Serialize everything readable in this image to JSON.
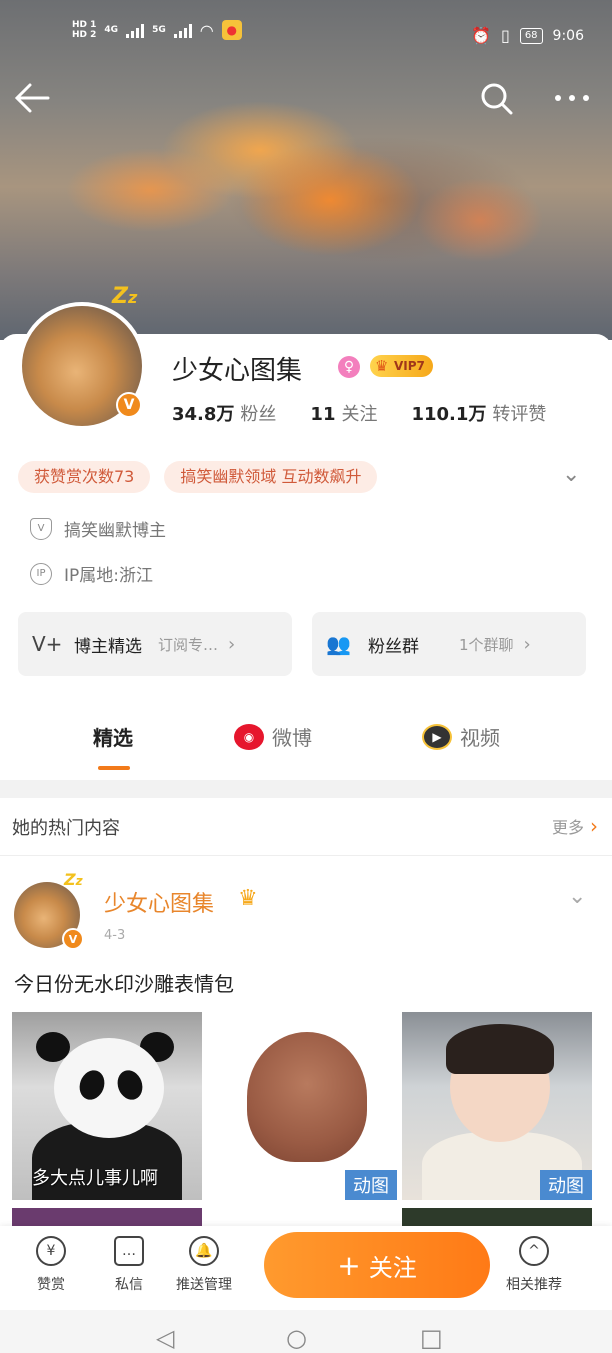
{
  "status_bar": {
    "sim1": "HD 1",
    "sim2": "HD 2",
    "net1": "4G",
    "net2": "5G",
    "battery": "68",
    "time": "9:06"
  },
  "nav": {
    "back_icon": "back-arrow",
    "search_icon": "search",
    "more_icon": "more-dots"
  },
  "profile": {
    "name": "少女心图集",
    "vip": "VIP7",
    "stats": [
      {
        "value": "34.8万",
        "label": "粉丝"
      },
      {
        "value": "11",
        "label": "关注"
      },
      {
        "value": "110.1万",
        "label": "转评赞"
      }
    ],
    "tags": [
      "获赞赏次数73",
      "搞笑幽默领域 互动数飙升"
    ],
    "role": "搞笑幽默博主",
    "ip": "IP属地:浙江",
    "boxes": [
      {
        "title": "博主精选",
        "sub": "订阅专…"
      },
      {
        "title": "粉丝群",
        "sub": "1个群聊"
      }
    ]
  },
  "tabs": [
    {
      "label": "精选",
      "active": true
    },
    {
      "label": "微博",
      "active": false
    },
    {
      "label": "视频",
      "active": false
    }
  ],
  "hot": {
    "title": "她的热门内容",
    "more": "更多"
  },
  "post": {
    "author": "少女心图集",
    "date": "4-3",
    "text": "今日份无水印沙雕表情包",
    "images": [
      {
        "caption": "多大点儿事儿啊",
        "badge": ""
      },
      {
        "caption": "",
        "badge": "动图"
      },
      {
        "caption": "",
        "badge": "动图"
      }
    ]
  },
  "bottom_bar": {
    "reward": "赞赏",
    "message": "私信",
    "push": "推送管理",
    "follow": "关注",
    "related": "相关推荐"
  },
  "colors": {
    "accent": "#f27a1a",
    "vip_gold": "#f6a81a",
    "tag_bg": "#fdece5",
    "gif_badge": "#4a8ad0"
  }
}
